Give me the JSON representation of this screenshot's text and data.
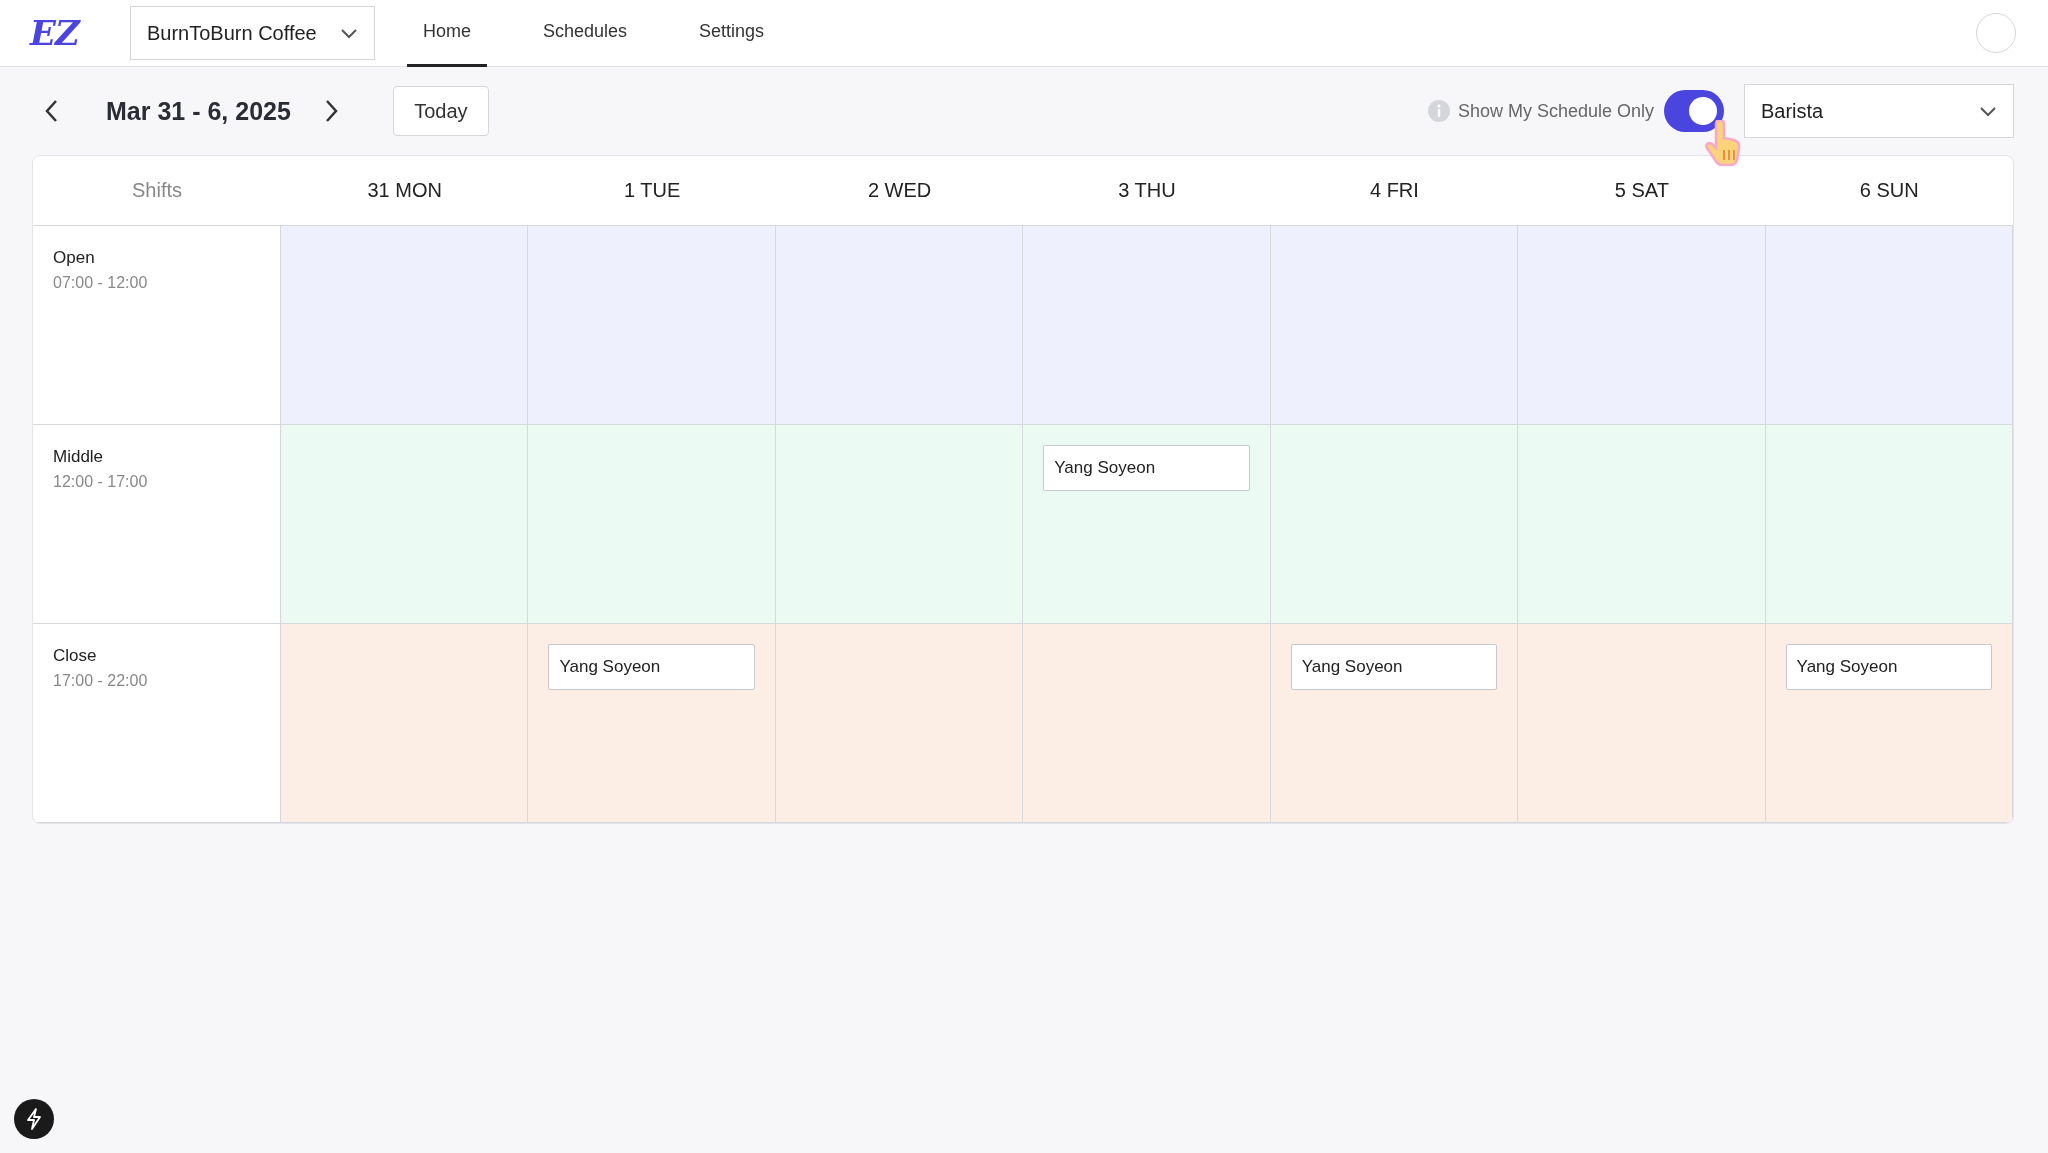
{
  "header": {
    "logo": "EZ",
    "store": "BurnToBurn Coffee",
    "tabs": [
      {
        "label": "Home",
        "selected": true
      },
      {
        "label": "Schedules",
        "selected": false
      },
      {
        "label": "Settings",
        "selected": false
      }
    ]
  },
  "toolbar": {
    "date_range": "Mar 31 - 6, 2025",
    "today": "Today",
    "toggle_label": "Show My Schedule Only",
    "toggle_on": true,
    "role": "Barista"
  },
  "table": {
    "corner": "Shifts",
    "days": [
      "31 MON",
      "1 TUE",
      "2 WED",
      "3 THU",
      "4 FRI",
      "5 SAT",
      "6 SUN"
    ],
    "shifts": [
      {
        "name": "Open",
        "time": "07:00 - 12:00",
        "color": "#eef0fd",
        "cells": [
          {},
          {},
          {},
          {},
          {},
          {},
          {}
        ]
      },
      {
        "name": "Middle",
        "time": "12:00 - 17:00",
        "color": "#ebfbf3",
        "cells": [
          {},
          {},
          {},
          {
            "assignee": "Yang Soyeon"
          },
          {},
          {},
          {}
        ]
      },
      {
        "name": "Close",
        "time": "17:00 - 22:00",
        "color": "#fdeee5",
        "cells": [
          {},
          {
            "assignee": "Yang Soyeon"
          },
          {},
          {},
          {
            "assignee": "Yang Soyeon"
          },
          {},
          {
            "assignee": "Yang Soyeon"
          }
        ]
      }
    ]
  }
}
